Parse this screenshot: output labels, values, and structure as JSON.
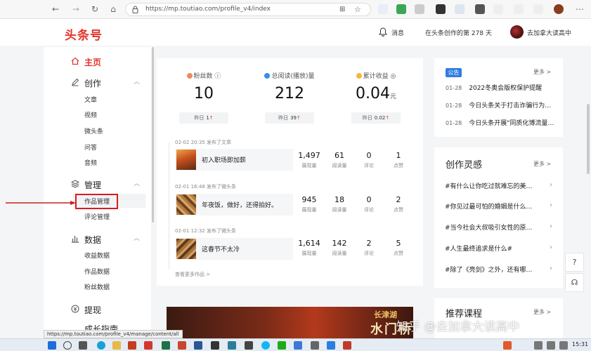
{
  "browser": {
    "url": "https://mp.toutiao.com/profile_v4/index",
    "status_url": "https://mp.toutiao.com/profile_v4/manage/content/all"
  },
  "header": {
    "logo": "头条号",
    "message_label": "消息",
    "days_text": "在头条创作的第 278 天",
    "username": "去加拿大读高中"
  },
  "sidebar": {
    "home": "主页",
    "create": "创作",
    "create_items": [
      "文章",
      "视频",
      "微头条",
      "问答",
      "音频"
    ],
    "manage": "管理",
    "manage_items": [
      "作品管理",
      "评论管理"
    ],
    "data": "数据",
    "data_items": [
      "收益数据",
      "作品数据",
      "粉丝数据"
    ],
    "withdraw": "提现",
    "growth": "成长指南"
  },
  "stats": [
    {
      "label": "粉丝数",
      "value": "10",
      "unit": "",
      "yesterday_label": "昨日",
      "yesterday_value": "1",
      "color": "#f08a5d"
    },
    {
      "label": "总阅读(播放)量",
      "value": "212",
      "unit": "",
      "yesterday_label": "昨日",
      "yesterday_value": "39",
      "color": "#3c8ce7"
    },
    {
      "label": "累计收益",
      "value": "0.04",
      "unit": "元",
      "yesterday_label": "昨日",
      "yesterday_value": "0.02",
      "color": "#f6b73c"
    }
  ],
  "posts": [
    {
      "meta": "02-02 20:35  发布了文章",
      "title": "初入职场即加薪",
      "views": "1,497",
      "reads": "61",
      "comments": "0",
      "likes": "1"
    },
    {
      "meta": "02-01 16:48  发布了微头条",
      "title": "年夜饭，做好，还得拍好。",
      "views": "945",
      "reads": "18",
      "comments": "0",
      "likes": "2"
    },
    {
      "meta": "02-01 12:32  发布了微头条",
      "title": "这春节不太冷",
      "views": "1,614",
      "reads": "142",
      "comments": "2",
      "likes": "5"
    }
  ],
  "metric_labels": {
    "views": "展现量",
    "reads": "阅读量",
    "comments": "评论",
    "likes": "点赞"
  },
  "more_works": "查看更多作品 >",
  "banner": {
    "line1": "长津湖",
    "line2": "水门桥"
  },
  "notice": {
    "tag": "公告",
    "more": "更多 >",
    "items": [
      {
        "date": "01-28",
        "text": "2022冬奥会版权保护提醒"
      },
      {
        "date": "01-28",
        "text": "今日头条关于打击诈骗行为…"
      },
      {
        "date": "01-28",
        "text": "今日头条开展\"同质化博流量…"
      }
    ]
  },
  "inspiration": {
    "title": "创作灵感",
    "more": "更多 >",
    "topics": [
      "#有什么让你吃过就难忘的美…",
      "#你见过最可怕的婚姻是什么…",
      "#当今社会大叔吸引女性的原…",
      "#人生最终追求是什么#",
      "#除了《亮剑》之外，还有哪…"
    ]
  },
  "courses": {
    "title": "推荐课程",
    "more": "更多 >"
  },
  "watermark": "知乎 @去加拿大读高中",
  "taskbar": {
    "time": "15:31"
  }
}
